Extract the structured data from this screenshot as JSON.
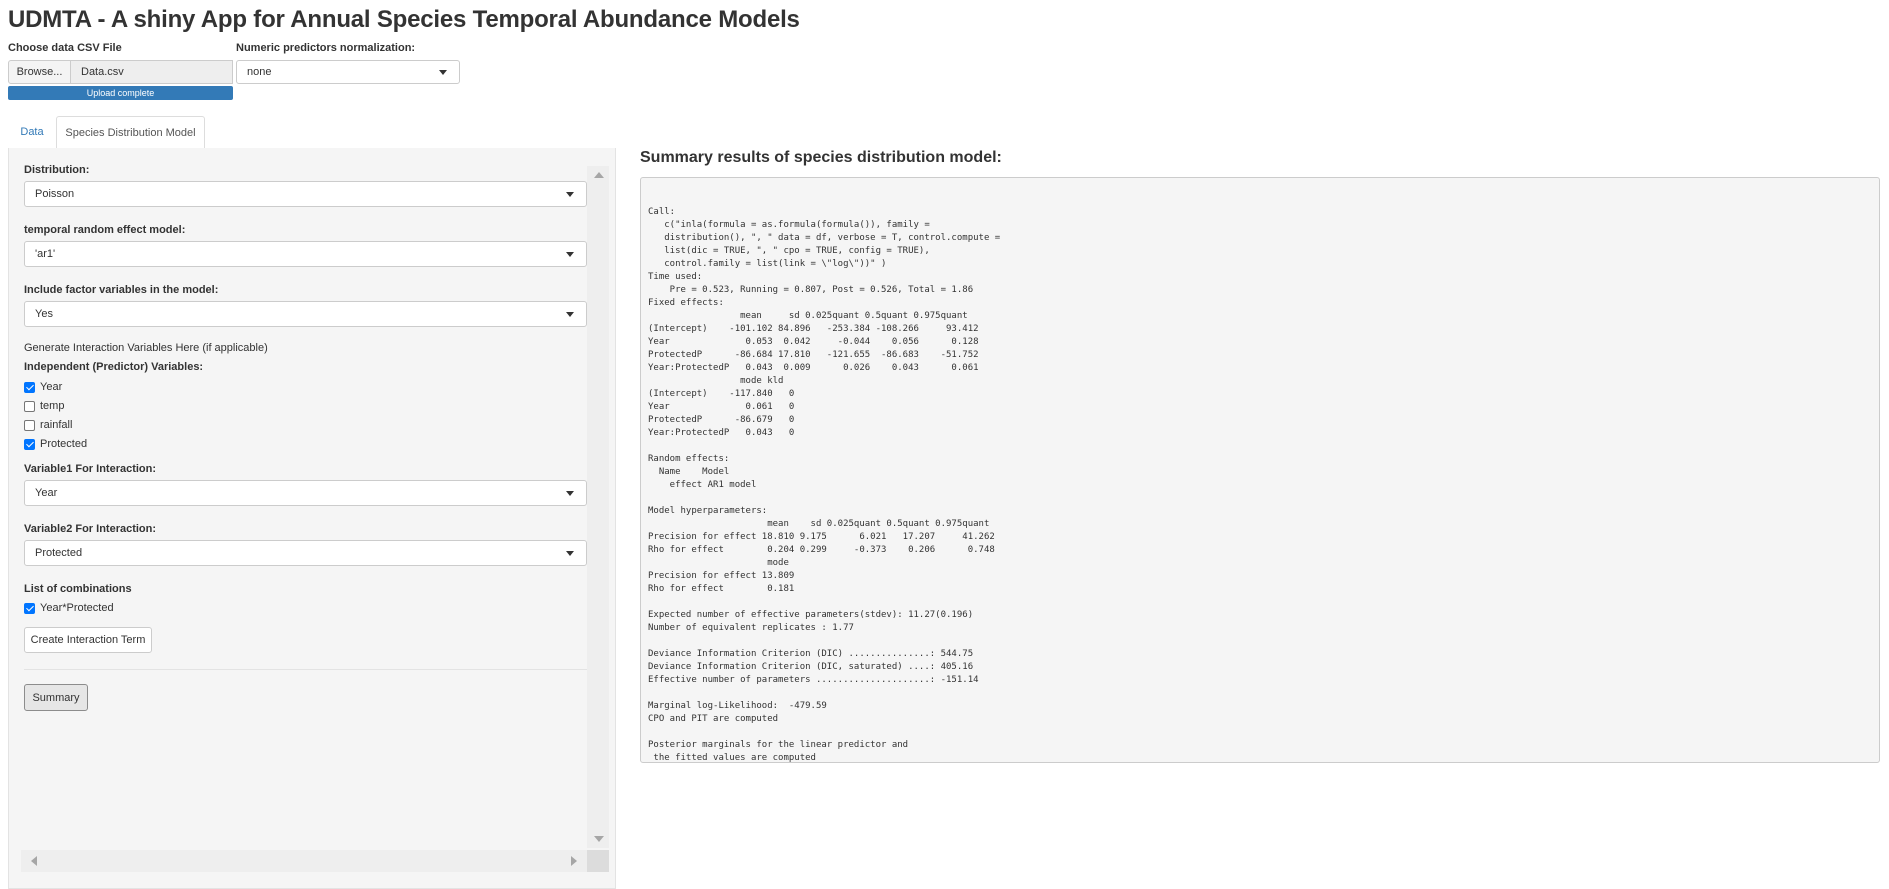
{
  "app": {
    "title": "UDMTA - A shiny App for Annual Species Temporal Abundance Models"
  },
  "file_input": {
    "label": "Choose data CSV File",
    "browse_label": "Browse...",
    "file_name": "Data.csv",
    "progress_text": "Upload complete",
    "progress_fraction": 1.0
  },
  "normalization": {
    "label": "Numeric predictors normalization:",
    "value": "none"
  },
  "tabs": [
    {
      "label": "Data",
      "active": false
    },
    {
      "label": "Species Distribution Model",
      "active": true
    }
  ],
  "sidebar": {
    "distribution": {
      "label": "Distribution:",
      "value": "Poisson"
    },
    "temporal": {
      "label": "temporal random effect model:",
      "value": "'ar1'"
    },
    "factor": {
      "label": "Include factor variables in the model:",
      "value": "Yes"
    },
    "interaction_note": "Generate Interaction Variables Here (if applicable)",
    "predictors_label": "Independent (Predictor) Variables:",
    "predictors": [
      {
        "label": "Year",
        "checked": true
      },
      {
        "label": "temp",
        "checked": false
      },
      {
        "label": "rainfall",
        "checked": false
      },
      {
        "label": "Protected",
        "checked": true
      }
    ],
    "var1": {
      "label": "Variable1 For Interaction:",
      "value": "Year"
    },
    "var2": {
      "label": "Variable2 For Interaction:",
      "value": "Protected"
    },
    "combinations_label": "List of combinations",
    "combinations": [
      {
        "label": "Year*Protected",
        "checked": true
      }
    ],
    "create_button": "Create Interaction Term",
    "summary_button": "Summary"
  },
  "results": {
    "title": "Summary results of species distribution model:",
    "text": "\nCall:\n   c(\"inla(formula = as.formula(formula()), family = \n   distribution(), \", \" data = df, verbose = T, control.compute = \n   list(dic = TRUE, \", \" cpo = TRUE, config = TRUE), \n   control.family = list(link = \\\"log\\\"))\" ) \nTime used:\n    Pre = 0.523, Running = 0.807, Post = 0.526, Total = 1.86 \nFixed effects:\n                 mean     sd 0.025quant 0.5quant 0.975quant\n(Intercept)    -101.102 84.896   -253.384 -108.266     93.412\nYear              0.053  0.042     -0.044    0.056      0.128\nProtectedP      -86.684 17.810   -121.655  -86.683    -51.752\nYear:ProtectedP   0.043  0.009      0.026    0.043      0.061\n                 mode kld\n(Intercept)    -117.840   0\nYear              0.061   0\nProtectedP      -86.679   0\nYear:ProtectedP   0.043   0\n\nRandom effects:\n  Name    Model\n    effect AR1 model\n\nModel hyperparameters:\n                      mean    sd 0.025quant 0.5quant 0.975quant\nPrecision for effect 18.810 9.175      6.021   17.207     41.262\nRho for effect        0.204 0.299     -0.373    0.206      0.748\n                      mode\nPrecision for effect 13.809\nRho for effect        0.181\n\nExpected number of effective parameters(stdev): 11.27(0.196)\nNumber of equivalent replicates : 1.77 \n\nDeviance Information Criterion (DIC) ...............: 544.75\nDeviance Information Criterion (DIC, saturated) ....: 405.16\nEffective number of parameters .....................: -151.14\n\nMarginal log-Likelihood:  -479.59 \nCPO and PIT are computed\n\nPosterior marginals for the linear predictor and\n the fitted values are computed"
  },
  "colors": {
    "accent": "#337ab7",
    "checkbox": "#0075ff",
    "panel_bg": "#f5f5f5"
  }
}
